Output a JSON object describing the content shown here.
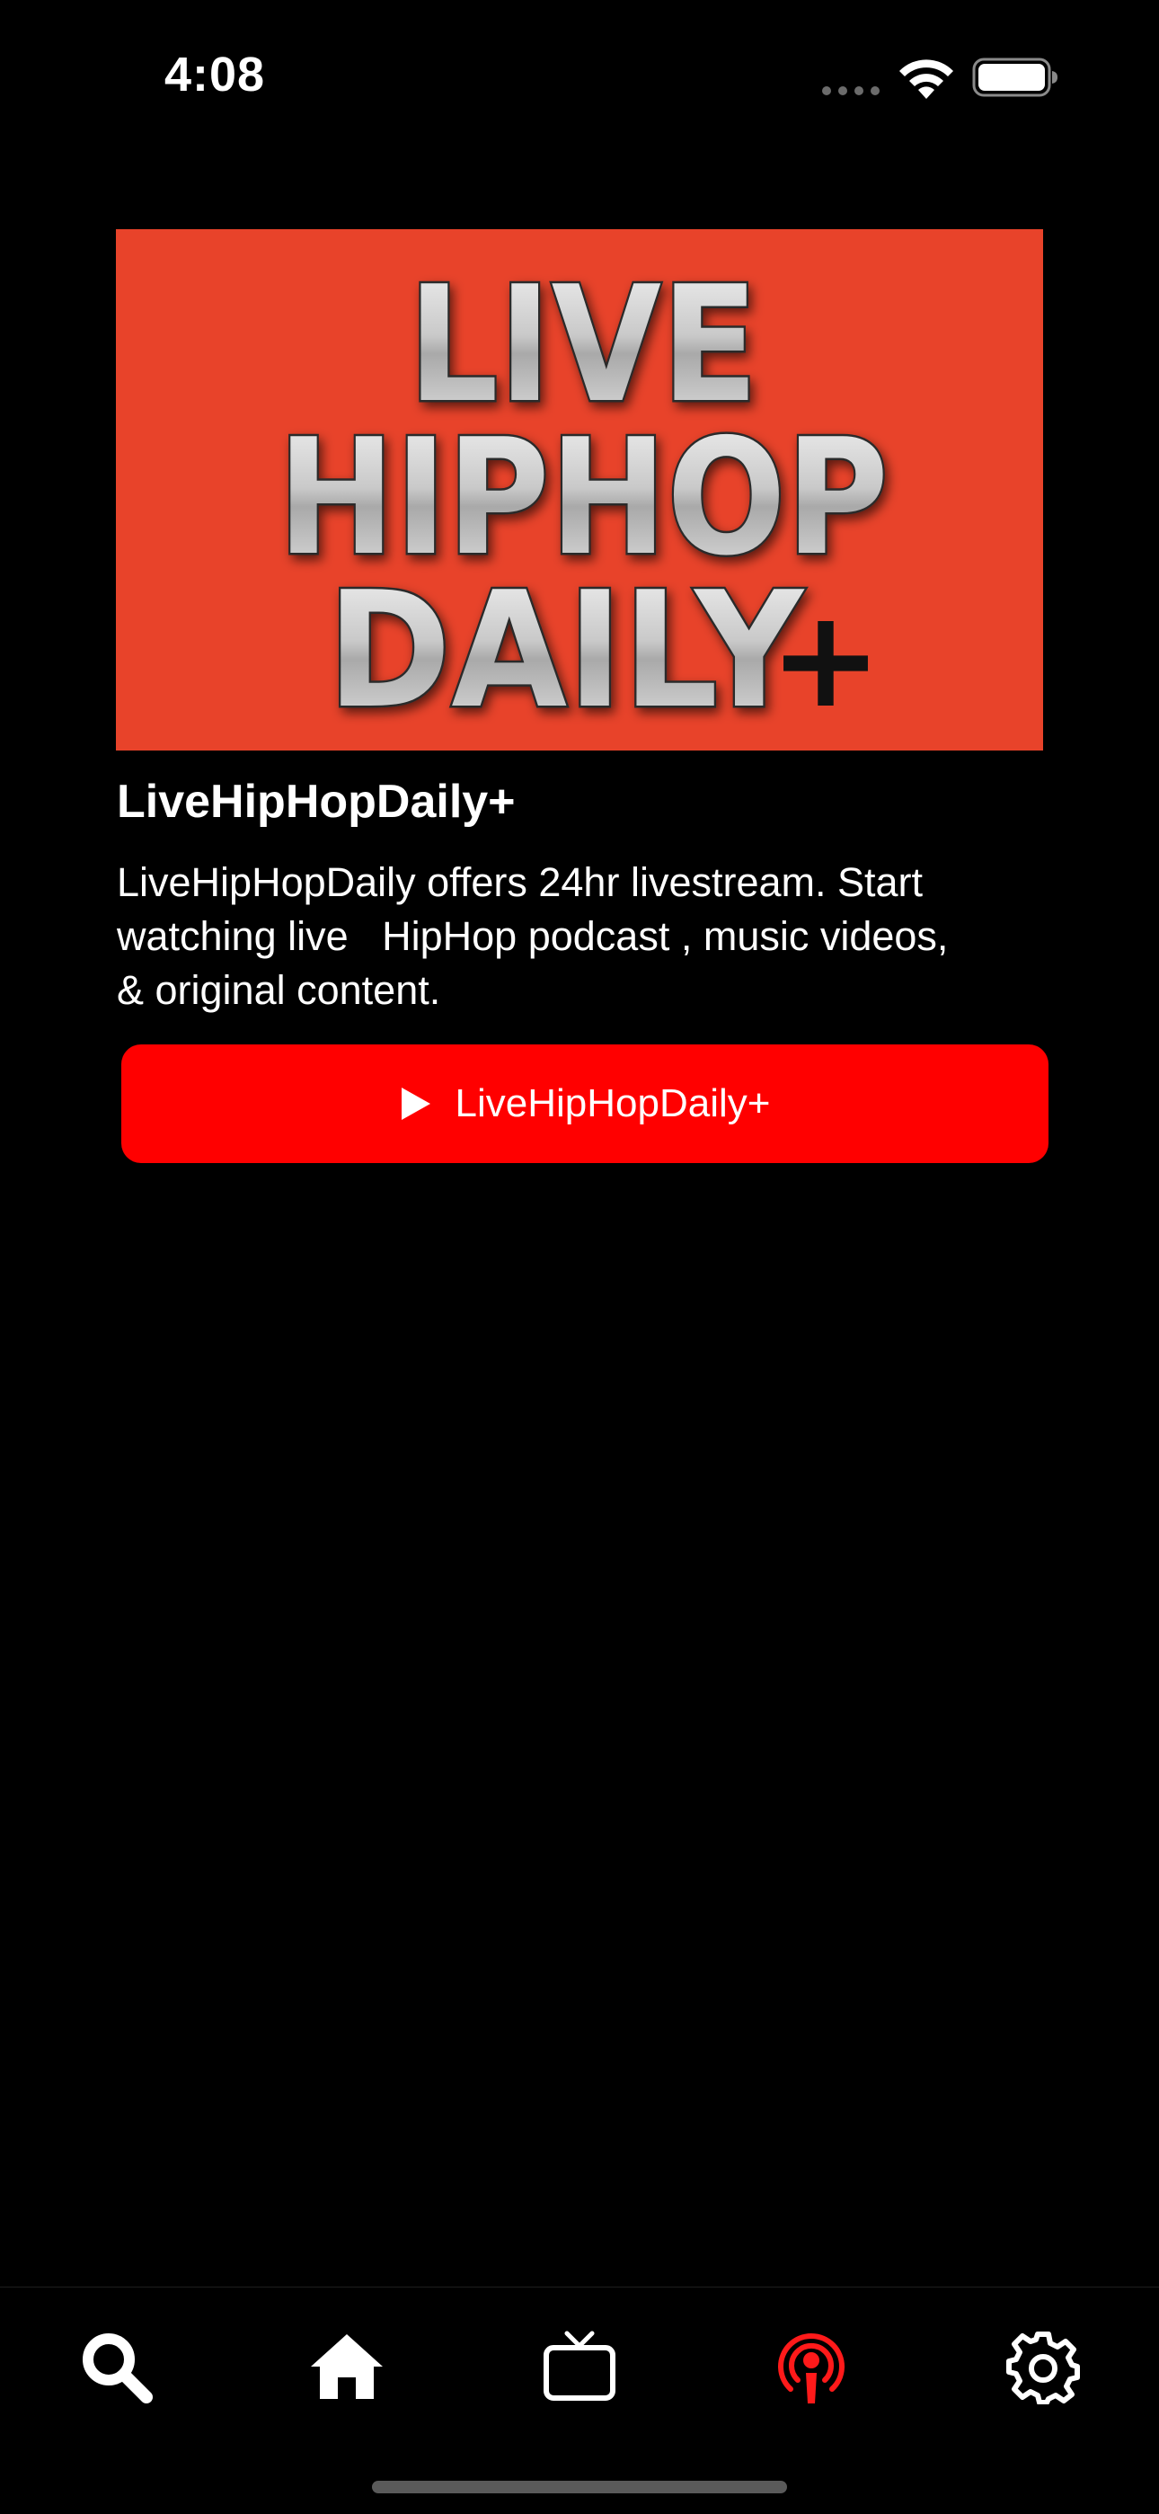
{
  "status_bar": {
    "time": "4:08",
    "icons": [
      "signal-dots-icon",
      "wifi-icon",
      "battery-icon"
    ]
  },
  "hero": {
    "line1": "LIVE",
    "line2": "HIPHOP",
    "line3": "DAILY",
    "plus": "+",
    "background": "#e8432a"
  },
  "item": {
    "title": "LiveHipHopDaily+",
    "description": "LiveHipHopDaily offers 24hr livestream. Start\nwatching live   HipHop podcast , music videos,\n& original content."
  },
  "play_button": {
    "label": "LiveHipHopDaily+",
    "icon": "play-icon",
    "color": "#ff0000"
  },
  "tab_bar": {
    "tabs": [
      {
        "icon": "search-icon",
        "active": false
      },
      {
        "icon": "home-icon",
        "active": false
      },
      {
        "icon": "tv-icon",
        "active": false
      },
      {
        "icon": "podcast-icon",
        "active": true
      },
      {
        "icon": "gear-icon",
        "active": false
      }
    ],
    "active_color": "#ff1a1a",
    "inactive_color": "#ffffff"
  }
}
